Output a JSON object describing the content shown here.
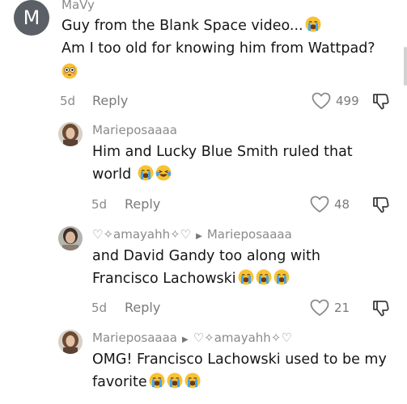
{
  "comments": [
    {
      "avatar_letter": "M",
      "username": "MaVy",
      "line1": "Guy from the Blank Space video...",
      "line2": "Am I too old for knowing him from Wattpad?",
      "time": "5d",
      "reply_label": "Reply",
      "likes": "499"
    },
    {
      "username": "Marieposaaaa",
      "line1": "Him and Lucky Blue Smith ruled that",
      "line2": "world",
      "time": "5d",
      "reply_label": "Reply",
      "likes": "48"
    },
    {
      "username": "♡✧amayahh✧♡",
      "reply_to": "Marieposaaaa",
      "line1": "and David Gandy too along with",
      "line2": "Francisco Lachowski",
      "time": "5d",
      "reply_label": "Reply",
      "likes": "21"
    },
    {
      "username": "Marieposaaaa",
      "reply_to": "♡✧amayahh✧♡",
      "line1": "OMG! Francisco Lachowski used to be my",
      "line2": "favorite"
    }
  ],
  "icons": {
    "crying": "loudly-crying-face-emoji",
    "joy": "face-with-tears-of-joy-emoji",
    "flushed": "flushed-face-emoji",
    "heart": "heart-outline-icon",
    "dislike": "thumbs-down-outline-icon"
  }
}
